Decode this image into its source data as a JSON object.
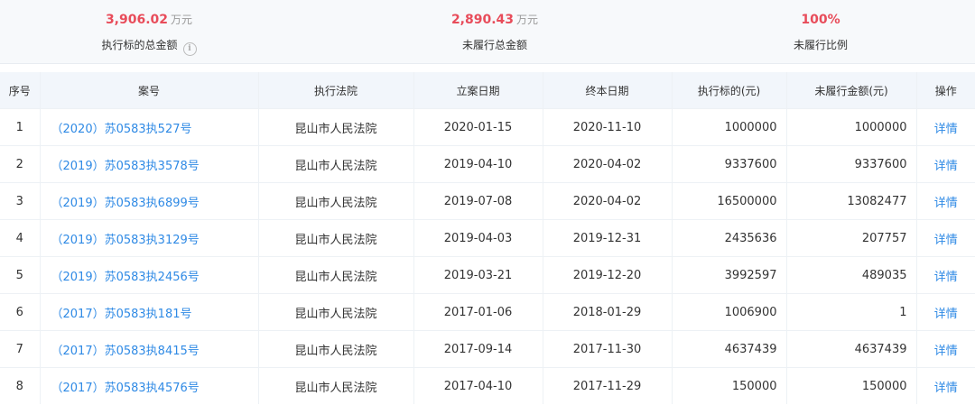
{
  "summary": {
    "total_amount": {
      "value": "3,906.02",
      "unit": "万元",
      "label": "执行标的总金额"
    },
    "unpaid_amount": {
      "value": "2,890.43",
      "unit": "万元",
      "label": "未履行总金额"
    },
    "unpaid_ratio": {
      "value": "100%",
      "label": "未履行比例"
    }
  },
  "icons": {
    "info": "info-circle-icon"
  },
  "colors": {
    "accent_red": "#e84c5a",
    "link_blue": "#2f8ae5",
    "header_bg": "#f2f6fb"
  },
  "table": {
    "headers": [
      "序号",
      "案号",
      "执行法院",
      "立案日期",
      "终本日期",
      "执行标的(元)",
      "未履行金额(元)",
      "操作"
    ],
    "rows": [
      {
        "index": "1",
        "case_no": "（2020）苏0583执527号",
        "court": "昆山市人民法院",
        "filed": "2020-01-15",
        "closed": "2020-11-10",
        "target": "1000000",
        "unpaid": "1000000",
        "action": "详情"
      },
      {
        "index": "2",
        "case_no": "（2019）苏0583执3578号",
        "court": "昆山市人民法院",
        "filed": "2019-04-10",
        "closed": "2020-04-02",
        "target": "9337600",
        "unpaid": "9337600",
        "action": "详情"
      },
      {
        "index": "3",
        "case_no": "（2019）苏0583执6899号",
        "court": "昆山市人民法院",
        "filed": "2019-07-08",
        "closed": "2020-04-02",
        "target": "16500000",
        "unpaid": "13082477",
        "action": "详情"
      },
      {
        "index": "4",
        "case_no": "（2019）苏0583执3129号",
        "court": "昆山市人民法院",
        "filed": "2019-04-03",
        "closed": "2019-12-31",
        "target": "2435636",
        "unpaid": "207757",
        "action": "详情"
      },
      {
        "index": "5",
        "case_no": "（2019）苏0583执2456号",
        "court": "昆山市人民法院",
        "filed": "2019-03-21",
        "closed": "2019-12-20",
        "target": "3992597",
        "unpaid": "489035",
        "action": "详情"
      },
      {
        "index": "6",
        "case_no": "（2017）苏0583执181号",
        "court": "昆山市人民法院",
        "filed": "2017-01-06",
        "closed": "2018-01-29",
        "target": "1006900",
        "unpaid": "1",
        "action": "详情"
      },
      {
        "index": "7",
        "case_no": "（2017）苏0583执8415号",
        "court": "昆山市人民法院",
        "filed": "2017-09-14",
        "closed": "2017-11-30",
        "target": "4637439",
        "unpaid": "4637439",
        "action": "详情"
      },
      {
        "index": "8",
        "case_no": "（2017）苏0583执4576号",
        "court": "昆山市人民法院",
        "filed": "2017-04-10",
        "closed": "2017-11-29",
        "target": "150000",
        "unpaid": "150000",
        "action": "详情"
      }
    ]
  }
}
